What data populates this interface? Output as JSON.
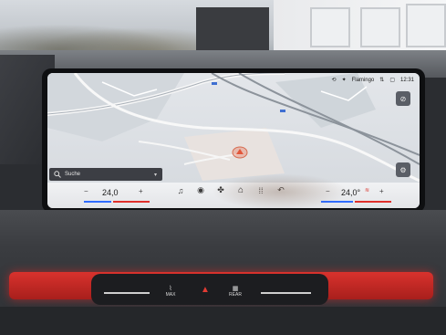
{
  "statusbar": {
    "profile_name": "Flamingo",
    "time": "12:31"
  },
  "map": {
    "search_placeholder": "Suche"
  },
  "climate": {
    "left_temp": "24,0",
    "right_temp": "24,0°"
  },
  "colors": {
    "accent_blue": "#2f6cff",
    "accent_red": "#e0302b",
    "dash_red": "#d9322d"
  },
  "dock_icons": [
    "music-icon",
    "camera-icon",
    "fan-icon",
    "home-icon",
    "apps-icon",
    "back-icon"
  ],
  "console": {
    "max_label": "MAX",
    "rear_label": "REAR"
  }
}
